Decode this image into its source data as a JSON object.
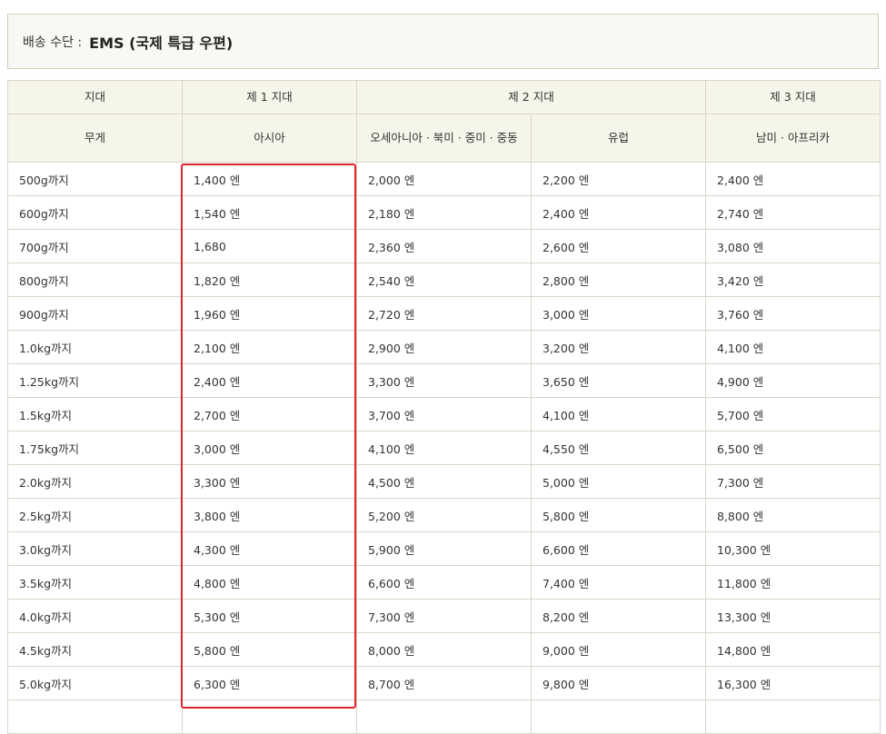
{
  "shipping": {
    "label": "배송 수단 :",
    "value": "EMS (국제 특급 우편)"
  },
  "table": {
    "header_row1": {
      "region": "지대",
      "zone1": "제 1 지대",
      "zone2": "제 2 지대",
      "zone3": "제 3 지대"
    },
    "header_row2": {
      "weight": "무게",
      "asia": "아시아",
      "oceania": "오세아니아 · 북미 · 중미 · 중동",
      "europe": "유럽",
      "south_america_africa": "남미 · 아프리카"
    },
    "rows": [
      {
        "weight": "500g까지",
        "asia": "1,400 엔",
        "oceania": "2,000 엔",
        "europe": "2,200 엔",
        "sa": "2,400 엔"
      },
      {
        "weight": "600g까지",
        "asia": "1,540 엔",
        "oceania": "2,180 엔",
        "europe": "2,400 엔",
        "sa": "2,740 엔"
      },
      {
        "weight": "700g까지",
        "asia": "1,680",
        "oceania": "2,360 엔",
        "europe": "2,600 엔",
        "sa": "3,080 엔"
      },
      {
        "weight": "800g까지",
        "asia": "1,820 엔",
        "oceania": "2,540 엔",
        "europe": "2,800 엔",
        "sa": "3,420 엔"
      },
      {
        "weight": "900g까지",
        "asia": "1,960 엔",
        "oceania": "2,720 엔",
        "europe": "3,000 엔",
        "sa": "3,760 엔"
      },
      {
        "weight": "1.0kg까지",
        "asia": "2,100 엔",
        "oceania": "2,900 엔",
        "europe": "3,200 엔",
        "sa": "4,100 엔"
      },
      {
        "weight": "1.25kg까지",
        "asia": "2,400 엔",
        "oceania": "3,300 엔",
        "europe": "3,650 엔",
        "sa": "4,900 엔"
      },
      {
        "weight": "1.5kg까지",
        "asia": "2,700 엔",
        "oceania": "3,700 엔",
        "europe": "4,100 엔",
        "sa": "5,700 엔"
      },
      {
        "weight": "1.75kg까지",
        "asia": "3,000 엔",
        "oceania": "4,100 엔",
        "europe": "4,550 엔",
        "sa": "6,500 엔"
      },
      {
        "weight": "2.0kg까지",
        "asia": "3,300 엔",
        "oceania": "4,500 엔",
        "europe": "5,000 엔",
        "sa": "7,300 엔"
      },
      {
        "weight": "2.5kg까지",
        "asia": "3,800 엔",
        "oceania": "5,200 엔",
        "europe": "5,800 엔",
        "sa": "8,800 엔"
      },
      {
        "weight": "3.0kg까지",
        "asia": "4,300 엔",
        "oceania": "5,900 엔",
        "europe": "6,600 엔",
        "sa": "10,300 엔"
      },
      {
        "weight": "3.5kg까지",
        "asia": "4,800 엔",
        "oceania": "6,600 엔",
        "europe": "7,400 엔",
        "sa": "11,800 엔"
      },
      {
        "weight": "4.0kg까지",
        "asia": "5,300 엔",
        "oceania": "7,300 엔",
        "europe": "8,200 엔",
        "sa": "13,300 엔"
      },
      {
        "weight": "4.5kg까지",
        "asia": "5,800 엔",
        "oceania": "8,000 엔",
        "europe": "9,000 엔",
        "sa": "14,800 엔"
      },
      {
        "weight": "5.0kg까지",
        "asia": "6,300 엔",
        "oceania": "8,700 엔",
        "europe": "9,800 엔",
        "sa": "16,300 엔"
      },
      {
        "weight": "",
        "asia": "",
        "oceania": "",
        "europe": "",
        "sa": ""
      }
    ]
  },
  "colors": {
    "header_bg": "#f6f5ea",
    "border": "#d8d6c8",
    "highlight": "#e3242b"
  }
}
